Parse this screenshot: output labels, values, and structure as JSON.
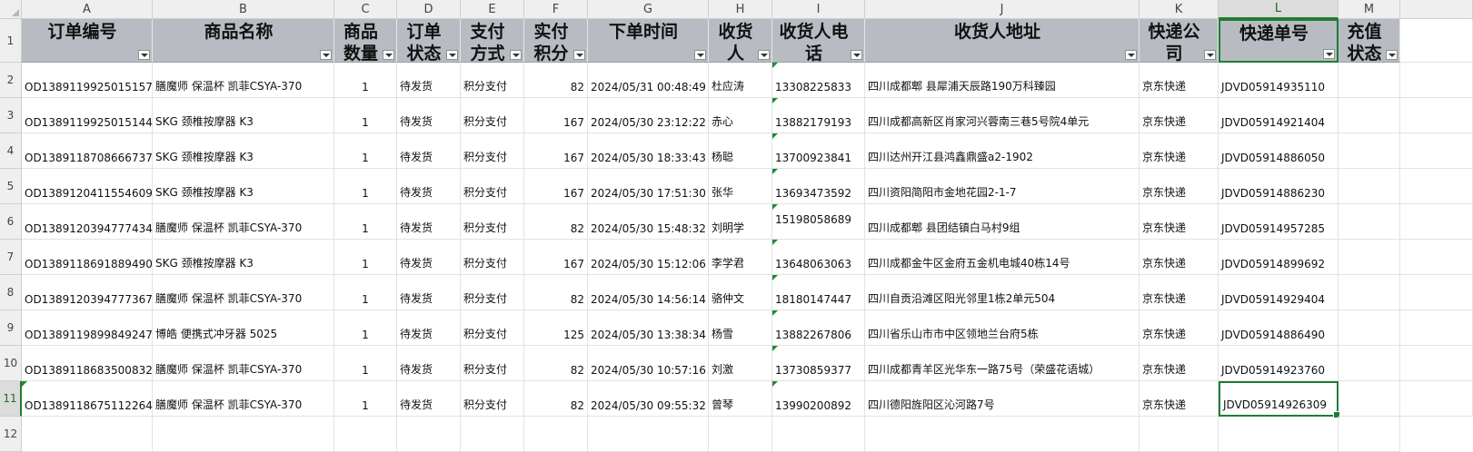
{
  "sheet": {
    "column_letters": [
      "A",
      "B",
      "C",
      "D",
      "E",
      "F",
      "G",
      "H",
      "I",
      "J",
      "K",
      "L",
      "M"
    ],
    "selected_column": "L",
    "selected_row": "11",
    "row_numbers": [
      "1",
      "2",
      "3",
      "4",
      "5",
      "6",
      "7",
      "8",
      "9",
      "10",
      "11",
      "12"
    ],
    "headers": [
      "订单编号",
      "商品名称",
      "商品数量",
      "订单状态",
      "支付方式",
      "实付积分",
      "下单时间",
      "收货人",
      "收货人电话",
      "收货人地址",
      "快递公司",
      "快递单号",
      "充值状态"
    ],
    "rows": [
      [
        "OD1389119925015157",
        "膳魔师 保温杯 凯菲CSYA-370",
        "1",
        "待发货",
        "积分支付",
        "82",
        "2024/05/31 00:48:49",
        "杜应涛",
        "13308225833",
        "四川成都郫 县犀浦天辰路190万科臻园",
        "京东快递",
        "JDVD05914935110",
        ""
      ],
      [
        "OD1389119925015144",
        "SKG 颈椎按摩器 K3",
        "1",
        "待发货",
        "积分支付",
        "167",
        "2024/05/30 23:12:22",
        "赤心",
        "13882179193",
        "四川成都高新区肖家河兴蓉南三巷5号院4单元",
        "京东快递",
        "JDVD05914921404",
        ""
      ],
      [
        "OD1389118708666737",
        "SKG 颈椎按摩器 K3",
        "1",
        "待发货",
        "积分支付",
        "167",
        "2024/05/30 18:33:43",
        "杨聪",
        "13700923841",
        "四川达州开江县鸿鑫鼎盛a2-1902",
        "京东快递",
        "JDVD05914886050",
        ""
      ],
      [
        "OD1389120411554609",
        "SKG 颈椎按摩器 K3",
        "1",
        "待发货",
        "积分支付",
        "167",
        "2024/05/30 17:51:30",
        "张华",
        "13693473592",
        "四川资阳简阳市金地花园2-1-7",
        "京东快递",
        "JDVD05914886230",
        ""
      ],
      [
        "OD1389120394777434",
        "膳魔师 保温杯 凯菲CSYA-370",
        "1",
        "待发货",
        "积分支付",
        "82",
        "2024/05/30 15:48:32",
        "刘明学",
        "15198058689",
        "四川成都郫 县团结镇白马村9组",
        "京东快递",
        "JDVD05914957285",
        ""
      ],
      [
        "OD1389118691889490",
        "SKG 颈椎按摩器 K3",
        "1",
        "待发货",
        "积分支付",
        "167",
        "2024/05/30 15:12:06",
        "李学君",
        "13648063063",
        "四川成都金牛区金府五金机电城40栋14号",
        "京东快递",
        "JDVD05914899692",
        ""
      ],
      [
        "OD1389120394777367",
        "膳魔师 保温杯 凯菲CSYA-370",
        "1",
        "待发货",
        "积分支付",
        "82",
        "2024/05/30 14:56:14",
        "骆仲文",
        "18180147447",
        "四川自贡沿滩区阳光邻里1栋2单元504",
        "京东快递",
        "JDVD05914929404",
        ""
      ],
      [
        "OD1389119899849247",
        "博皓 便携式冲牙器 5025",
        "1",
        "待发货",
        "积分支付",
        "125",
        "2024/05/30 13:38:34",
        "杨雪",
        "13882267806",
        "四川省乐山市市中区领地兰台府5栋",
        "京东快递",
        "JDVD05914886490",
        ""
      ],
      [
        "OD1389118683500832",
        "膳魔师 保温杯 凯菲CSYA-370",
        "1",
        "待发货",
        "积分支付",
        "82",
        "2024/05/30 10:57:16",
        "刘激",
        "13730859377",
        "四川成都青羊区光华东一路75号（荣盛花语城）",
        "京东快递",
        "JDVD05914923760",
        ""
      ],
      [
        "OD1389118675112264",
        "膳魔师 保温杯 凯菲CSYA-370",
        "1",
        "待发货",
        "积分支付",
        "82",
        "2024/05/30 09:55:32",
        "曾琴",
        "13990200892",
        "四川德阳旌阳区沁河路7号",
        "京东快递",
        "JDVD05914926309",
        ""
      ]
    ]
  },
  "colors": {
    "header_fill": "#b8bcc2",
    "selection_green": "#1e7d32",
    "error_triangle": "#1e8a37"
  }
}
